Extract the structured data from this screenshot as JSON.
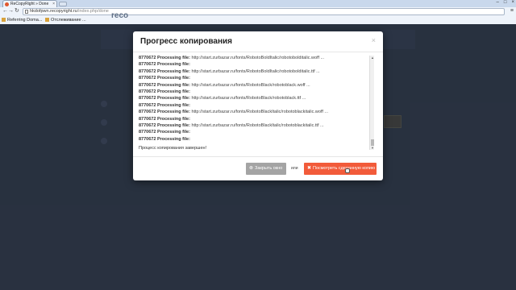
{
  "browser": {
    "tab_title": "ReCopyRight » Done",
    "address_host": "hkdofpwn.recopyright.ru",
    "address_path": "/index.php/done",
    "bookmarks": [
      "Referring Doma...",
      "Отслеживание ..."
    ]
  },
  "modal": {
    "title": "Прогресс копирования",
    "log_label": "8770672 Processing file:",
    "log_lines": [
      "http://start.zurbazar.ru/fonts/RobotoBoldItalic/robotobolditalic.woff ...",
      "",
      "http://start.zurbazar.ru/fonts/RobotoBoldItalic/robotobolditalic.ttf ...",
      "",
      "http://start.zurbazar.ru/fonts/RobotoBlack/robotoblack.woff ...",
      "",
      "http://start.zurbazar.ru/fonts/RobotoBlack/robotoblack.ttf ...",
      "",
      "http://start.zurbazar.ru/fonts/RobotoBlackItalic/robotoblackitalic.woff ...",
      "",
      "http://start.zurbazar.ru/fonts/RobotoBlackItalic/robotoblackitalic.ttf ...",
      ""
    ],
    "done_text": "Процесс копирования завершен!",
    "close_button": "Закрыть окно",
    "or_text": "или",
    "view_button": "Посмотреть сделанную копию"
  },
  "page": {
    "header_text": "reco"
  },
  "colors": {
    "accent": "#f25b3a",
    "secondary_button": "#a4a4a4",
    "background": "#2f3a4b"
  }
}
